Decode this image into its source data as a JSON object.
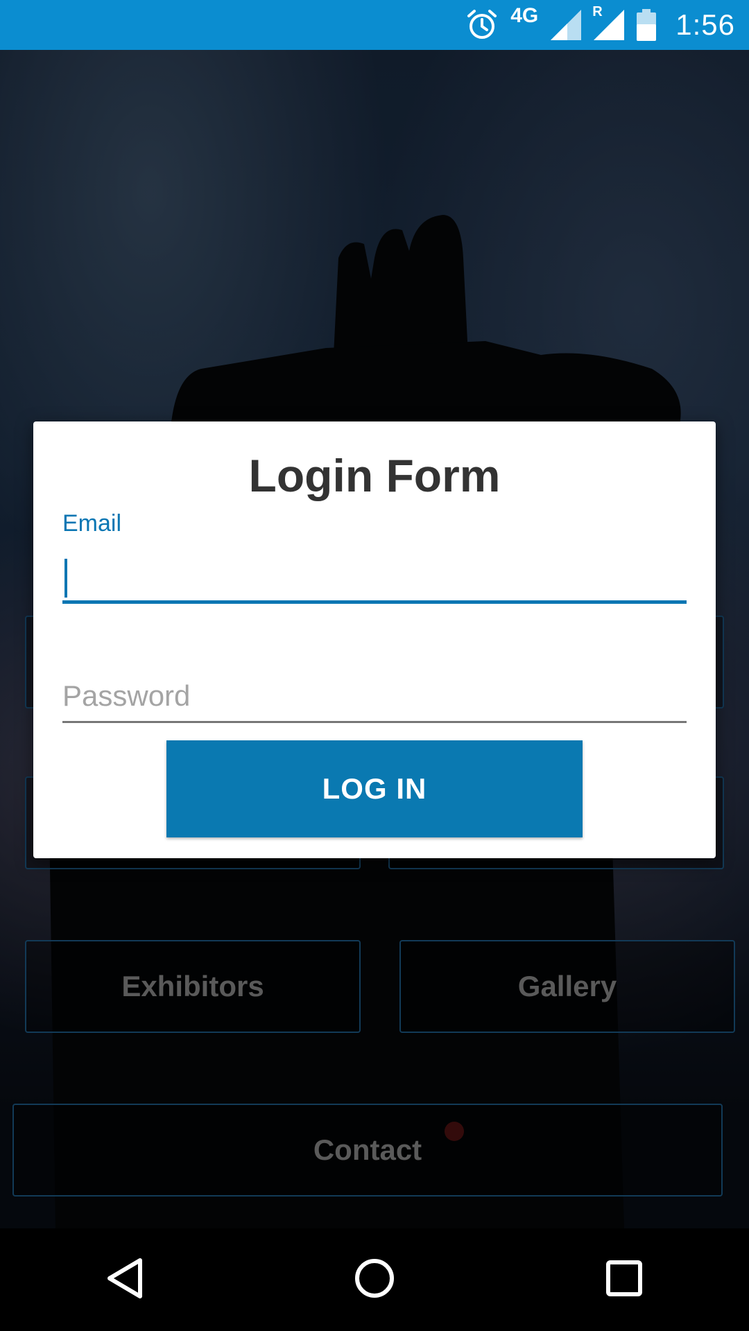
{
  "status_bar": {
    "time": "1:56",
    "network": "4G",
    "roaming": "R",
    "icons": [
      "alarm-icon",
      "signal-icon",
      "roaming-signal-icon",
      "battery-icon"
    ]
  },
  "menu": {
    "exhibitors": "Exhibitors",
    "gallery": "Gallery",
    "contact": "Contact"
  },
  "dialog": {
    "title": "Login Form",
    "email_label": "Email",
    "email_value": "",
    "password_placeholder": "Password",
    "login_button": "LOG IN"
  },
  "nav": {
    "back": "back-icon",
    "home": "home-icon",
    "recents": "recents-icon"
  },
  "colors": {
    "status_bar": "#0b8dd0",
    "accent": "#0a76b3",
    "button": "#0a79b1"
  }
}
